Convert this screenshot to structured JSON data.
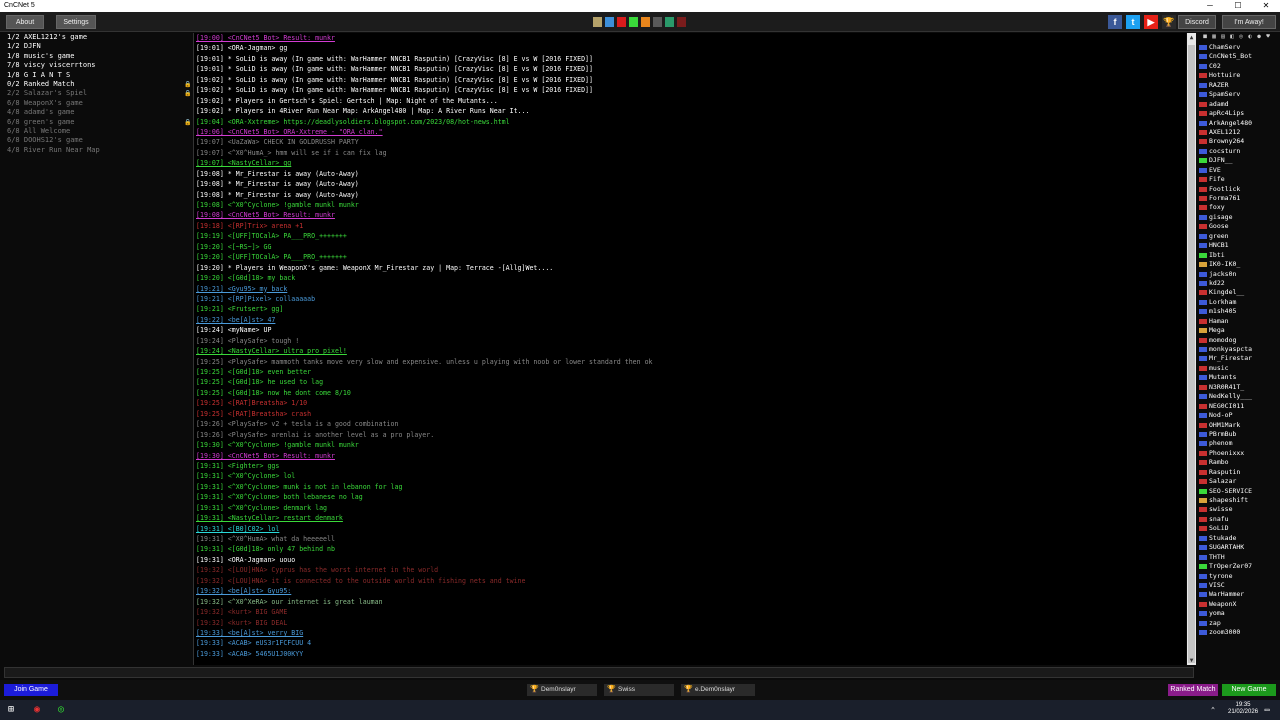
{
  "window": {
    "title": "CnCNet 5",
    "minimize": "─",
    "maximize": "☐",
    "close": "✕"
  },
  "toolbar": {
    "about_label": "About",
    "settings_label": "Settings",
    "discord_label": "Discord",
    "away_label": "I'm Away!",
    "color_swatches": [
      "#b5a26a",
      "#3d8fd9",
      "#d91c1c",
      "#3ad93a",
      "#e8861c",
      "#5a5a5a",
      "#2a9a6a",
      "#7a1c1c"
    ],
    "social": [
      {
        "icon": "facebook-icon",
        "glyph": "f",
        "color": "#3b5998"
      },
      {
        "icon": "twitter-icon",
        "glyph": "t",
        "color": "#1da1f2"
      },
      {
        "icon": "youtube-icon",
        "glyph": "▶",
        "color": "#e62117"
      },
      {
        "icon": "trophy-icon",
        "glyph": "🏆",
        "color": "#2a2a2a"
      }
    ]
  },
  "rooms": [
    {
      "label": "1/2 AXEL1212's game",
      "dim": false,
      "locked": false
    },
    {
      "label": "1/2 DJFN",
      "dim": false,
      "locked": false
    },
    {
      "label": "1/8 music's game",
      "dim": false,
      "locked": false
    },
    {
      "label": "7/8 viscy viscerrtons",
      "dim": false,
      "locked": false
    },
    {
      "label": "1/8 G I A N T S",
      "dim": false,
      "locked": false
    },
    {
      "label": "0/2 Ranked Match",
      "dim": false,
      "locked": true
    },
    {
      "label": "2/2 Salazar's Spiel",
      "dim": true,
      "locked": true
    },
    {
      "label": "6/8 WeaponX's game",
      "dim": true,
      "locked": false
    },
    {
      "label": "4/8 adamd's game",
      "dim": true,
      "locked": false
    },
    {
      "label": "6/8 green's game",
      "dim": true,
      "locked": true
    },
    {
      "label": "6/8 All Welcome",
      "dim": true,
      "locked": false
    },
    {
      "label": "6/8 DOOHS12's game",
      "dim": true,
      "locked": false
    },
    {
      "label": "4/8 River Run Near Map",
      "dim": true,
      "locked": false
    }
  ],
  "chat": [
    {
      "text": "[19:00] <CnCNet5_Bot> Result: munkr",
      "color": "#d23cd2",
      "u": true
    },
    {
      "text": "[19:01] <ORA-Jagman> gg",
      "color": "#ffffff",
      "u": false
    },
    {
      "text": "[19:01] * SoLiD is away (In game with: WarHammer NNCB1 Rasputin) [CrazyVisc [8] E vs W [2016 FIXED]]",
      "color": "#ffffff",
      "u": false
    },
    {
      "text": "[19:01] * SoLiD is away (In game with: WarHammer NNCB1 Rasputin) [CrazyVisc [8] E vs W [2016 FIXED]]",
      "color": "#ffffff",
      "u": false
    },
    {
      "text": "[19:02] * SoLiD is away (In game with: WarHammer NNCB1 Rasputin) [CrazyVisc [8] E vs W [2016 FIXED]]",
      "color": "#ffffff",
      "u": false
    },
    {
      "text": "[19:02] * SoLiD is away (In game with: WarHammer NNCB1 Rasputin) [CrazyVisc [8] E vs W [2016 FIXED]]",
      "color": "#ffffff",
      "u": false
    },
    {
      "text": "[19:02] * Players in Gertsch's Spiel: Gertsch | Map: Night of the Mutants...",
      "color": "#ffffff",
      "u": false
    },
    {
      "text": "[19:02] * Players in 4River Run Near Map: ArkAngel480 | Map: A River Runs Near It...",
      "color": "#ffffff",
      "u": false
    },
    {
      "text": "[19:04] <ORA-Xxtreme> https://deadlysoldiers.blogspot.com/2023/08/hot-news.html",
      "color": "#3ad93a",
      "u": false
    },
    {
      "text": "[19:06] <CnCNet5_Bot> ORA-Xxtreme - \"ORA clan.\"",
      "color": "#d23cd2",
      "u": true
    },
    {
      "text": "[19:07] <UaZaWa> CHECK IN GOLDRUSSH PARTY",
      "color": "#888888",
      "u": false
    },
    {
      "text": "[19:07] <^X0^HumA_> hmm will se if i can fix lag",
      "color": "#888888",
      "u": false
    },
    {
      "text": "[19:07] <NastyCellar> gg",
      "color": "#3ad93a",
      "u": true
    },
    {
      "text": "[19:08] * Mr_Firestar is away (Auto-Away)",
      "color": "#ffffff",
      "u": false
    },
    {
      "text": "[19:08] * Mr_Firestar is away (Auto-Away)",
      "color": "#ffffff",
      "u": false
    },
    {
      "text": "[19:08] * Mr_Firestar is away (Auto-Away)",
      "color": "#ffffff",
      "u": false
    },
    {
      "text": "[19:08] <^X0^Cyclone> !gamble munkl munkr",
      "color": "#3ad93a",
      "u": false
    },
    {
      "text": "[19:08] <CnCNet5_Bot> Result: munkr",
      "color": "#d23cd2",
      "u": true
    },
    {
      "text": "[19:18] <[RP]Trix> arena +1",
      "color": "#c83030",
      "u": false
    },
    {
      "text": "[19:19] <[UFF]TOCalA> PA___PRO_+++++++",
      "color": "#3ad93a",
      "u": false
    },
    {
      "text": "[19:20] <[~RS~]> GG",
      "color": "#3ad93a",
      "u": false
    },
    {
      "text": "[19:20] <[UFF]TOCalA> PA___PRO_+++++++",
      "color": "#3ad93a",
      "u": false
    },
    {
      "text": "[19:20] * Players in WeaponX's game: WeaponX Mr_Firestar zay | Map: Terrace -[Allg]Wet....",
      "color": "#ffffff",
      "u": false
    },
    {
      "text": "[19:20] <[G0d]18> my back",
      "color": "#3ad93a",
      "u": false
    },
    {
      "text": "[19:21] <Gyu95> my back",
      "color": "#4a9ad9",
      "u": true
    },
    {
      "text": "[19:21] <[RP]Pixel> collaaaaab",
      "color": "#4a9ad9",
      "u": false
    },
    {
      "text": "[19:21] <Frutsert> gg]",
      "color": "#3ad93a",
      "u": false
    },
    {
      "text": "[19:22] <be[A]st> 47",
      "color": "#4a9ad9",
      "u": true
    },
    {
      "text": "[19:24] <myName> UP",
      "color": "#ffffff",
      "u": false
    },
    {
      "text": "[19:24] <PlaySafe> tough !",
      "color": "#888888",
      "u": false
    },
    {
      "text": "[19:24] <NastyCellar> ultra pro pixel!",
      "color": "#3ad93a",
      "u": true
    },
    {
      "text": "[19:25] <PlaySafe> mammoth tanks move very slow and expensive. unless u playing with noob or lower standard then ok",
      "color": "#888888",
      "u": false
    },
    {
      "text": "[19:25] <[G0d]18> even better",
      "color": "#3ad93a",
      "u": false
    },
    {
      "text": "[19:25] <[G0d]18> he used to lag",
      "color": "#3ad93a",
      "u": false
    },
    {
      "text": "[19:25] <[G0d]18> now he dont come 8/10",
      "color": "#3ad93a",
      "u": false
    },
    {
      "text": "[19:25] <[RAT]Breatsha> 1/10",
      "color": "#c83030",
      "u": false
    },
    {
      "text": "[19:25] <[RAT]Breatsha> crash",
      "color": "#c83030",
      "u": false
    },
    {
      "text": "[19:26] <PlaySafe> v2 + tesla is a good combination",
      "color": "#888888",
      "u": false
    },
    {
      "text": "[19:26] <PlaySafe> arenlai is another level as a pro player.",
      "color": "#888888",
      "u": false
    },
    {
      "text": "[19:30] <^X0^Cyclone> !gamble munkl munkr",
      "color": "#3ad93a",
      "u": false
    },
    {
      "text": "[19:30] <CnCNet5_Bot> Result: munkr",
      "color": "#d23cd2",
      "u": true
    },
    {
      "text": "[19:31] <Fighter> ggs",
      "color": "#3ad93a",
      "u": false
    },
    {
      "text": "[19:31] <^X0^Cyclone> lol",
      "color": "#3ad93a",
      "u": false
    },
    {
      "text": "[19:31] <^X0^Cyclone> munk is not in lebanon for lag",
      "color": "#3ad93a",
      "u": false
    },
    {
      "text": "[19:31] <^X0^Cyclone> both lebanese no lag",
      "color": "#3ad93a",
      "u": false
    },
    {
      "text": "[19:31] <^X0^Cyclone> denmark lag",
      "color": "#3ad93a",
      "u": false
    },
    {
      "text": "[19:31] <NastyCellar> restart denmark",
      "color": "#3ad93a",
      "u": true
    },
    {
      "text": "[19:31] <[B0]C02> lol",
      "color": "#2ad9d9",
      "u": true
    },
    {
      "text": "[19:31] <^X0^HumA> what da heeeeell",
      "color": "#888888",
      "u": false
    },
    {
      "text": "[19:31] <[G0d]18> only 47 behind nb",
      "color": "#3ad93a",
      "u": false
    },
    {
      "text": "[19:31] <ORA-Jagman> uouo",
      "color": "#ffffff",
      "u": false
    },
    {
      "text": "[19:32] <[LOU]HNA> Cyprus has the worst internet in the world",
      "color": "#8a2a2a",
      "u": false
    },
    {
      "text": "[19:32] <[LOU]HNA> it is connected to the outside world with fishing nets and twine",
      "color": "#8a2a2a",
      "u": false
    },
    {
      "text": "[19:32] <be[A]st> Gyu95:",
      "color": "#4a9ad9",
      "u": true
    },
    {
      "text": "[19:32] <^X0^XeRA> our internet is great lauman",
      "color": "#88bb88",
      "u": false
    },
    {
      "text": "[19:32] <kurt> BIG GAME",
      "color": "#8a2a2a",
      "u": false
    },
    {
      "text": "[19:32] <kurt> BIG DEAL",
      "color": "#8a2a2a",
      "u": false
    },
    {
      "text": "[19:33] <be[A]st> verry BIG",
      "color": "#4a9ad9",
      "u": true
    },
    {
      "text": "[19:33] <ACAB> eUS3r1FCFCUU 4",
      "color": "#4a9ad9",
      "u": false
    },
    {
      "text": "[19:33] <ACAB> 5465U1J00KYY",
      "color": "#4a9ad9",
      "u": false
    }
  ],
  "userlist_icons": [
    "■",
    "▦",
    "▤",
    "◧",
    "◎",
    "◐",
    "●",
    "♥"
  ],
  "users": [
    {
      "name": "ChamServ",
      "flag": "#3d5ad9"
    },
    {
      "name": "CnCNet5_Bot",
      "flag": "#3d5ad9"
    },
    {
      "name": "C02",
      "flag": "#3d5ad9"
    },
    {
      "name": "Hottuire",
      "flag": "#c83030"
    },
    {
      "name": "RAZER",
      "flag": "#3d5ad9"
    },
    {
      "name": "SpamServ",
      "flag": "#3d5ad9"
    },
    {
      "name": "adamd",
      "flag": "#c83030"
    },
    {
      "name": "apRc4Lips",
      "flag": "#c83030"
    },
    {
      "name": "ArkAngel480",
      "flag": "#3d5ad9"
    },
    {
      "name": "AXEL1212",
      "flag": "#c83030"
    },
    {
      "name": "Browny264",
      "flag": "#c83030"
    },
    {
      "name": "cocsturn",
      "flag": "#3d5ad9"
    },
    {
      "name": "DJFN__",
      "flag": "#3ad93a"
    },
    {
      "name": "EVE",
      "flag": "#3d5ad9"
    },
    {
      "name": "Fife",
      "flag": "#c83030"
    },
    {
      "name": "Footlick",
      "flag": "#c83030"
    },
    {
      "name": "Forma761",
      "flag": "#c83030"
    },
    {
      "name": "foxy",
      "flag": "#c83030"
    },
    {
      "name": "gisage",
      "flag": "#3d5ad9"
    },
    {
      "name": "Goose",
      "flag": "#c83030"
    },
    {
      "name": "green",
      "flag": "#3d5ad9"
    },
    {
      "name": "HNCB1",
      "flag": "#3d5ad9"
    },
    {
      "name": "Ibti",
      "flag": "#3ad93a"
    },
    {
      "name": "IK0-IK0_",
      "flag": "#d9a33a"
    },
    {
      "name": "jacks0n",
      "flag": "#3d5ad9"
    },
    {
      "name": "kd22",
      "flag": "#3d5ad9"
    },
    {
      "name": "Kingdel__",
      "flag": "#c83030"
    },
    {
      "name": "Lorkham",
      "flag": "#3d5ad9"
    },
    {
      "name": "m1sh405",
      "flag": "#3d5ad9"
    },
    {
      "name": "Haman",
      "flag": "#c83030"
    },
    {
      "name": "Mega",
      "flag": "#d9a33a"
    },
    {
      "name": "momodog",
      "flag": "#c83030"
    },
    {
      "name": "monkyaspcta",
      "flag": "#3d5ad9"
    },
    {
      "name": "Mr_Firestar",
      "flag": "#3d5ad9"
    },
    {
      "name": "music",
      "flag": "#c83030"
    },
    {
      "name": "Mutants",
      "flag": "#3d5ad9"
    },
    {
      "name": "N3R0R41T_",
      "flag": "#c83030"
    },
    {
      "name": "NedKelly___",
      "flag": "#3d5ad9"
    },
    {
      "name": "NEG0CI011",
      "flag": "#c83030"
    },
    {
      "name": "Nod-oP",
      "flag": "#3d5ad9"
    },
    {
      "name": "OHM1Mark",
      "flag": "#c83030"
    },
    {
      "name": "PBrmBub",
      "flag": "#3d5ad9"
    },
    {
      "name": "phenom",
      "flag": "#3d5ad9"
    },
    {
      "name": "Phoenixxx",
      "flag": "#c83030"
    },
    {
      "name": "Rambo",
      "flag": "#c83030"
    },
    {
      "name": "Rasputin",
      "flag": "#c83030"
    },
    {
      "name": "Salazar",
      "flag": "#c83030"
    },
    {
      "name": "SEO-SERVICE",
      "flag": "#3ad93a"
    },
    {
      "name": "shapeshift",
      "flag": "#d9a33a"
    },
    {
      "name": "swisse",
      "flag": "#c83030"
    },
    {
      "name": "snafu",
      "flag": "#c83030"
    },
    {
      "name": "SoLiD",
      "flag": "#c83030"
    },
    {
      "name": "Stukade",
      "flag": "#3d5ad9"
    },
    {
      "name": "SUGARTAHK",
      "flag": "#3d5ad9"
    },
    {
      "name": "THTH",
      "flag": "#3d5ad9"
    },
    {
      "name": "TrOperZer07",
      "flag": "#3ad93a"
    },
    {
      "name": "tyrone",
      "flag": "#3d5ad9"
    },
    {
      "name": "VISC",
      "flag": "#3d5ad9"
    },
    {
      "name": "WarHammer",
      "flag": "#3d5ad9"
    },
    {
      "name": "WeaponX",
      "flag": "#c83030"
    },
    {
      "name": "yoma",
      "flag": "#3d5ad9"
    },
    {
      "name": "zap",
      "flag": "#3d5ad9"
    },
    {
      "name": "zoom3000",
      "flag": "#3d5ad9"
    }
  ],
  "bottom": {
    "join_label": "Join Game",
    "ranked_label": "Ranked Match",
    "new_label": "New Game",
    "lobbies": [
      {
        "label": "Dem0nslayr"
      },
      {
        "label": "Swiss"
      },
      {
        "label": "e.Dem0nslayr"
      }
    ]
  },
  "taskbar": {
    "time": "19:35",
    "date": "21/02/2026"
  }
}
